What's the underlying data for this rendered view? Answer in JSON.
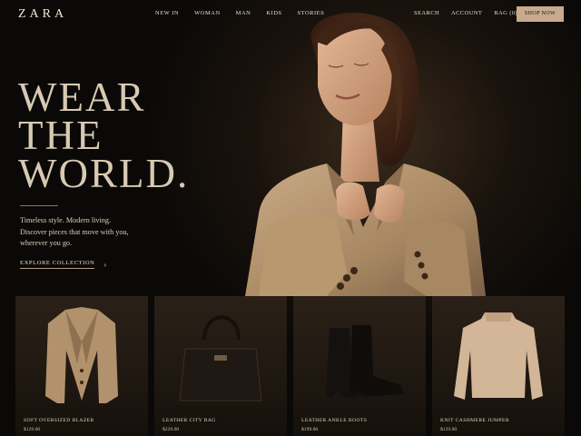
{
  "header": {
    "logo": "ZARA",
    "nav": [
      "NEW IN",
      "WOMAN",
      "MAN",
      "KIDS",
      "STORIES"
    ],
    "right_nav": [
      "SEARCH",
      "ACCOUNT",
      "BAG (0)"
    ],
    "cta": "SHOP NOW"
  },
  "hero": {
    "headline": [
      "WEAR",
      "THE",
      "WORLD."
    ],
    "subtext": [
      "Timeless style. Modern living.",
      "Discover pieces that move with you,",
      "wherever you go."
    ],
    "link_label": "EXPLORE COLLECTION",
    "link_icon": "chevron-right-icon"
  },
  "products": [
    {
      "name": "SOFT OVERSIZED BLAZER",
      "price": "$129.00"
    },
    {
      "name": "LEATHER CITY BAG",
      "price": "$229.00"
    },
    {
      "name": "LEATHER ANKLE BOOTS",
      "price": "$199.00"
    },
    {
      "name": "KNIT CASHMERE JUMPER",
      "price": "$129.00"
    }
  ],
  "colors": {
    "background": "#0b0907",
    "accent": "#c7ab8c",
    "text": "#e7dccb"
  }
}
